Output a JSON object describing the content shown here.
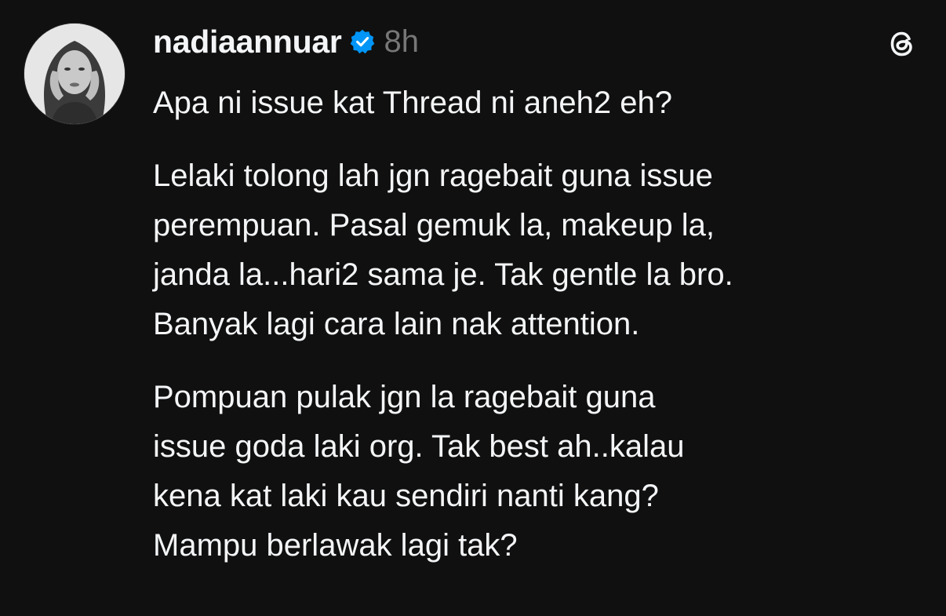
{
  "post": {
    "username": "nadiaannuar",
    "verified": true,
    "timestamp": "8h",
    "paragraphs": [
      [
        "Apa ni issue kat Thread ni aneh2 eh?"
      ],
      [
        "Lelaki tolong lah jgn ragebait guna issue",
        "perempuan. Pasal gemuk la, makeup la,",
        "janda la...hari2 sama je. Tak gentle la bro.",
        "Banyak lagi cara lain nak attention."
      ],
      [
        "Pompuan pulak jgn la ragebait guna",
        "issue goda laki org. Tak best ah..kalau",
        "kena kat laki kau sendiri nanti kang?",
        "Mampu berlawak lagi tak?"
      ]
    ]
  },
  "icons": {
    "avatar": "profile-photo",
    "verified": "verified-badge-icon",
    "app": "threads-logo-icon"
  },
  "colors": {
    "background": "#101010",
    "text": "#f3f5f7",
    "muted": "#777777",
    "verified": "#0095f6"
  }
}
